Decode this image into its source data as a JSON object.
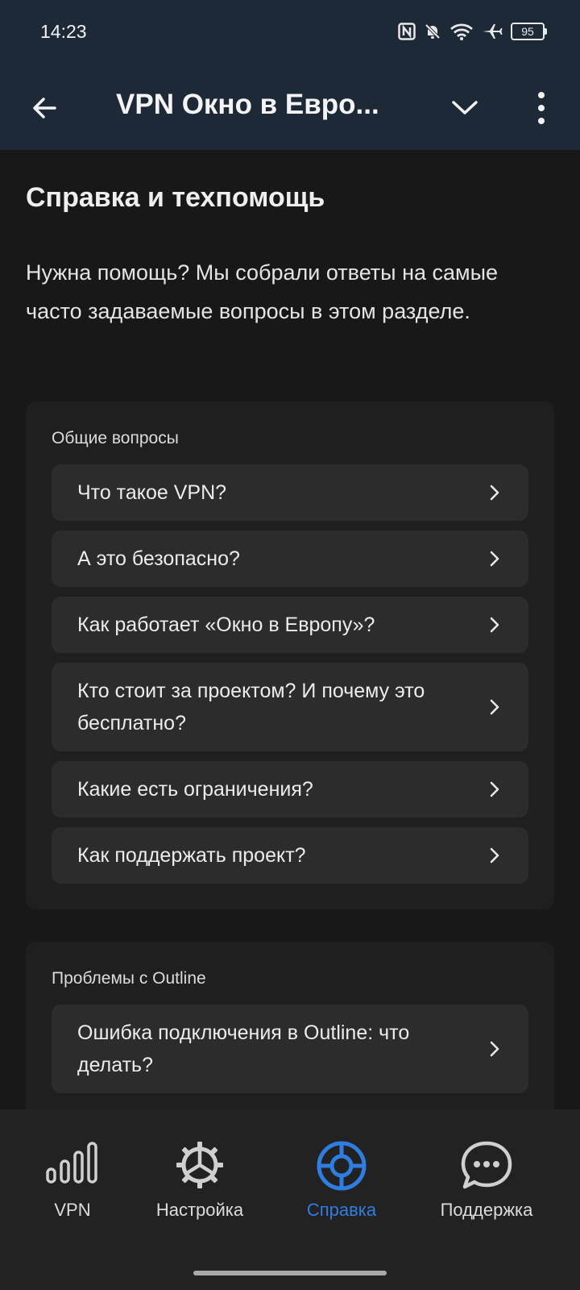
{
  "status": {
    "time": "14:23",
    "battery": "95"
  },
  "appbar": {
    "title": "VPN Окно в Евро..."
  },
  "page": {
    "title": "Справка и техпомощь",
    "intro": "Нужна помощь? Мы собрали ответы на самые часто задаваемые вопросы в этом разделе."
  },
  "sections": [
    {
      "title": "Общие вопросы",
      "items": [
        "Что такое VPN?",
        "А это безопасно?",
        "Как работает «Окно в Европу»?",
        "Кто стоит за проектом? И почему это бесплатно?",
        "Какие есть ограничения?",
        "Как поддержать проект?"
      ]
    },
    {
      "title": "Проблемы с Outline",
      "items": [
        "Ошибка подключения в Outline: что делать?"
      ]
    }
  ],
  "nav": {
    "tabs": [
      {
        "label": "VPN",
        "icon": "signal-bars-icon"
      },
      {
        "label": "Настройка",
        "icon": "gear-icon"
      },
      {
        "label": "Справка",
        "icon": "lifebuoy-icon",
        "active": true
      },
      {
        "label": "Поддержка",
        "icon": "chat-bubble-icon"
      }
    ],
    "active_color": "#2f7de0"
  }
}
